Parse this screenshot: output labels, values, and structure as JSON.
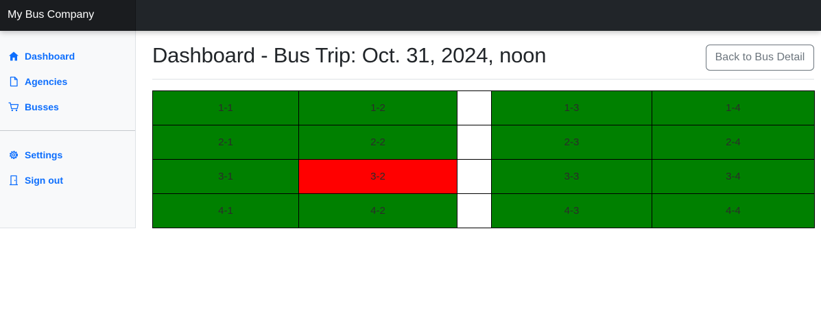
{
  "brand": {
    "name": "My Bus Company"
  },
  "sidebar": {
    "primary": [
      {
        "label": "Dashboard",
        "icon": "home-icon"
      },
      {
        "label": "Agencies",
        "icon": "file-icon"
      },
      {
        "label": "Busses",
        "icon": "cart-icon"
      }
    ],
    "secondary": [
      {
        "label": "Settings",
        "icon": "gear-icon"
      },
      {
        "label": "Sign out",
        "icon": "door-icon"
      }
    ]
  },
  "main": {
    "title": "Dashboard - Bus Trip: Oct. 31, 2024, noon",
    "back_button": "Back to Bus Detail"
  },
  "seat_map": {
    "colors": {
      "available": "#008000",
      "taken": "#ff0000",
      "aisle": "#ffffff"
    },
    "rows": [
      {
        "left": [
          {
            "label": "1-1",
            "status": "available"
          },
          {
            "label": "1-2",
            "status": "available"
          }
        ],
        "right": [
          {
            "label": "1-3",
            "status": "available"
          },
          {
            "label": "1-4",
            "status": "available"
          }
        ]
      },
      {
        "left": [
          {
            "label": "2-1",
            "status": "available"
          },
          {
            "label": "2-2",
            "status": "available"
          }
        ],
        "right": [
          {
            "label": "2-3",
            "status": "available"
          },
          {
            "label": "2-4",
            "status": "available"
          }
        ]
      },
      {
        "left": [
          {
            "label": "3-1",
            "status": "available"
          },
          {
            "label": "3-2",
            "status": "taken"
          }
        ],
        "right": [
          {
            "label": "3-3",
            "status": "available"
          },
          {
            "label": "3-4",
            "status": "available"
          }
        ]
      },
      {
        "left": [
          {
            "label": "4-1",
            "status": "available"
          },
          {
            "label": "4-2",
            "status": "available"
          }
        ],
        "right": [
          {
            "label": "4-3",
            "status": "available"
          },
          {
            "label": "4-4",
            "status": "available"
          }
        ]
      }
    ]
  }
}
